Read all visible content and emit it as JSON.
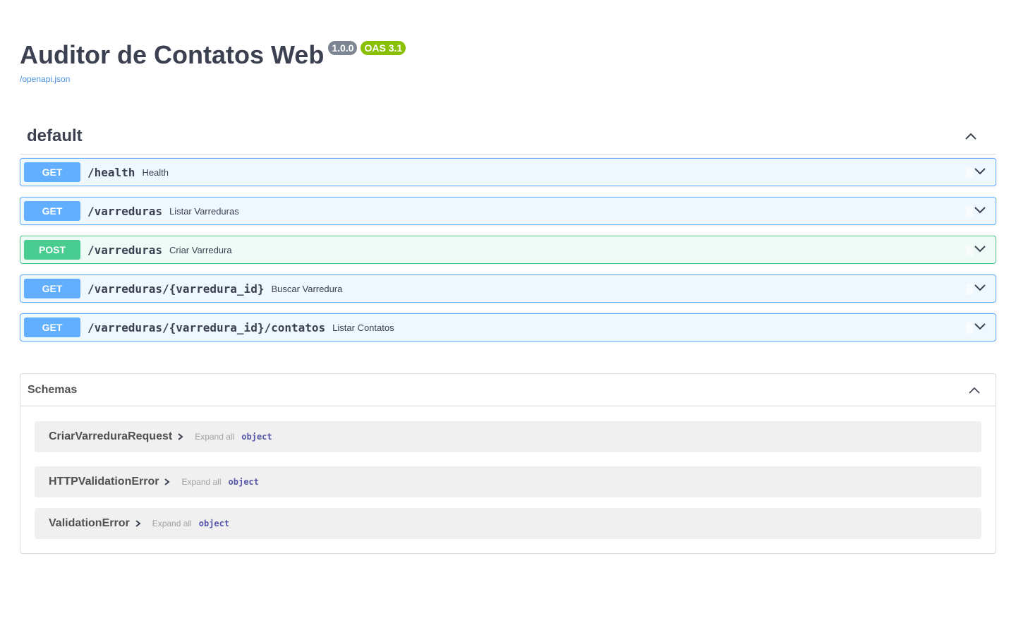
{
  "info": {
    "title": "Auditor de Contatos Web",
    "version_badge": "1.0.0",
    "oas_badge": "OAS 3.1",
    "spec_link": "/openapi.json"
  },
  "tag": {
    "name": "default",
    "icon": "chevron-up-icon"
  },
  "operations": [
    {
      "method": "GET",
      "path": "/health",
      "summary": "Health"
    },
    {
      "method": "GET",
      "path": "/varreduras",
      "summary": "Listar Varreduras"
    },
    {
      "method": "POST",
      "path": "/varreduras",
      "summary": "Criar Varredura"
    },
    {
      "method": "GET",
      "path": "/varreduras/{varredura_id}",
      "summary": "Buscar Varredura"
    },
    {
      "method": "GET",
      "path": "/varreduras/{varredura_id}/contatos",
      "summary": "Listar Contatos"
    }
  ],
  "schemas": {
    "title": "Schemas",
    "models": [
      {
        "name": "CriarVarreduraRequest",
        "expand_all": "Expand all",
        "type": "object"
      },
      {
        "name": "HTTPValidationError",
        "expand_all": "Expand all",
        "type": "object"
      },
      {
        "name": "ValidationError",
        "expand_all": "Expand all",
        "type": "object"
      }
    ]
  },
  "colors": {
    "get": "#61affe",
    "post": "#49cc90",
    "version_badge": "#7d8492",
    "oas_badge": "#89bf04",
    "link": "#4990e2"
  }
}
